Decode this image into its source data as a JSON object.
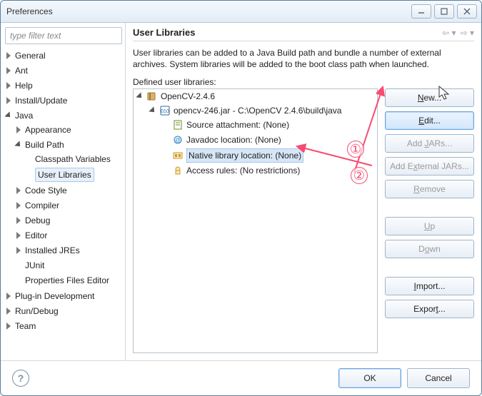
{
  "window": {
    "title": "Preferences",
    "min_tooltip": "Minimize",
    "max_tooltip": "Maximize",
    "close_tooltip": "Close"
  },
  "filter": {
    "placeholder": "type filter text"
  },
  "categories": {
    "general": "General",
    "ant": "Ant",
    "help": "Help",
    "install": "Install/Update",
    "java": "Java",
    "java_children": {
      "appearance": "Appearance",
      "buildpath": "Build Path",
      "buildpath_children": {
        "classpath": "Classpath Variables",
        "userlibs": "User Libraries"
      },
      "codestyle": "Code Style",
      "compiler": "Compiler",
      "debug": "Debug",
      "editor": "Editor",
      "installedjres": "Installed JREs",
      "junit": "JUnit",
      "propfiles": "Properties Files Editor"
    },
    "pde": "Plug-in Development",
    "rundebug": "Run/Debug",
    "team": "Team"
  },
  "page": {
    "heading": "User Libraries",
    "description": "User libraries can be added to a Java Build path and bundle a number of external archives. System libraries will be added to the boot class path when launched.",
    "defined_label": "Defined user libraries:"
  },
  "library": {
    "name": "OpenCV-2.4.6",
    "jar": "opencv-246.jar - C:\\OpenCV 2.4.6\\build\\java",
    "src": "Source attachment: (None)",
    "javadoc": "Javadoc location: (None)",
    "native": "Native library location: (None)",
    "access": "Access rules: (No restrictions)"
  },
  "buttons": {
    "new": "New...",
    "edit": "Edit...",
    "addjars": "Add JARs...",
    "addext": "Add External JARs...",
    "remove": "Remove",
    "up": "Up",
    "down": "Down",
    "import": "Import...",
    "export": "Export..."
  },
  "footer": {
    "ok": "OK",
    "cancel": "Cancel"
  },
  "annotations": {
    "one": "①",
    "two": "②"
  }
}
